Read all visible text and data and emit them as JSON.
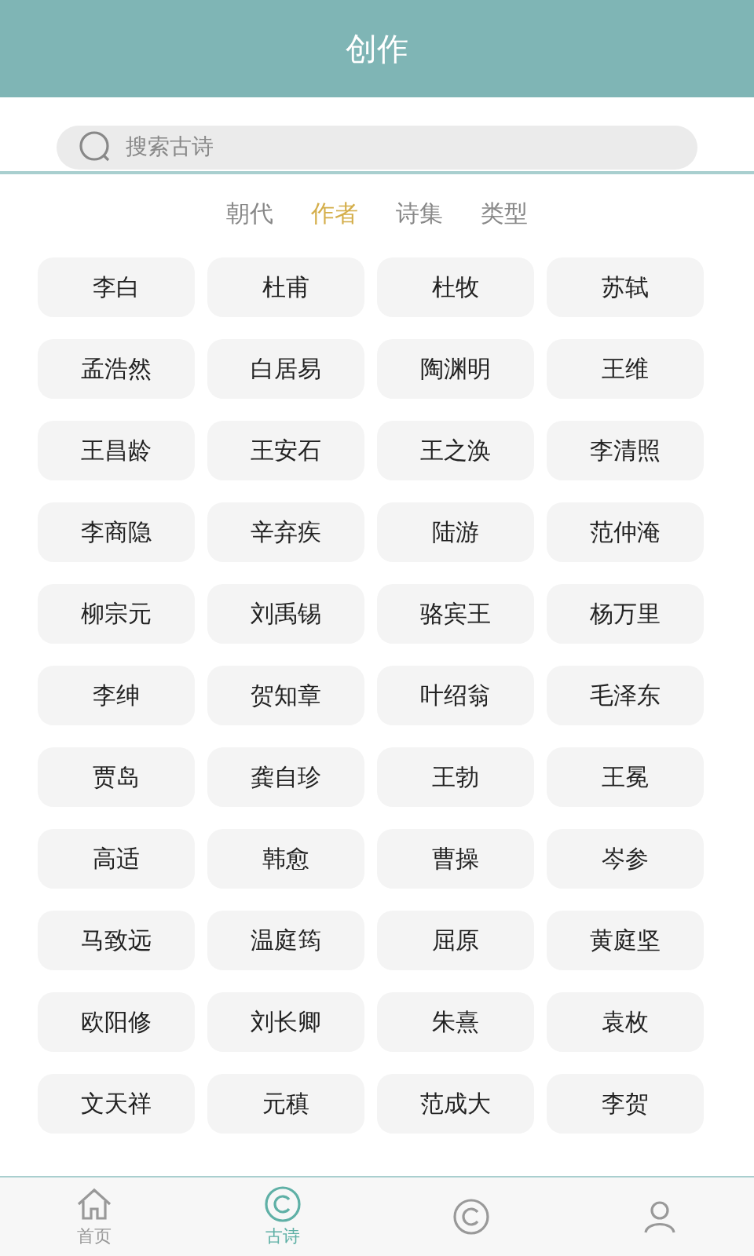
{
  "header": {
    "title": "创作"
  },
  "search": {
    "placeholder": "搜索古诗"
  },
  "tabs": [
    {
      "label": "朝代",
      "selected": false
    },
    {
      "label": "作者",
      "selected": true
    },
    {
      "label": "诗集",
      "selected": false
    },
    {
      "label": "类型",
      "selected": false
    }
  ],
  "authors": [
    "李白",
    "杜甫",
    "杜牧",
    "苏轼",
    "孟浩然",
    "白居易",
    "陶渊明",
    "王维",
    "王昌龄",
    "王安石",
    "王之涣",
    "李清照",
    "李商隐",
    "辛弃疾",
    "陆游",
    "范仲淹",
    "柳宗元",
    "刘禹锡",
    "骆宾王",
    "杨万里",
    "李绅",
    "贺知章",
    "叶绍翁",
    "毛泽东",
    "贾岛",
    "龚自珍",
    "王勃",
    "王冕",
    "高适",
    "韩愈",
    "曹操",
    "岑参",
    "马致远",
    "温庭筠",
    "屈原",
    "黄庭坚",
    "欧阳修",
    "刘长卿",
    "朱熹",
    "袁枚",
    "文天祥",
    "元稹",
    "范成大",
    "李贺"
  ],
  "nav": [
    {
      "kind": "home",
      "label": "首页",
      "selected": false
    },
    {
      "kind": "copyright",
      "label": "古诗",
      "selected": true
    },
    {
      "kind": "copyright",
      "selected": false
    },
    {
      "kind": "person",
      "selected": false
    }
  ]
}
